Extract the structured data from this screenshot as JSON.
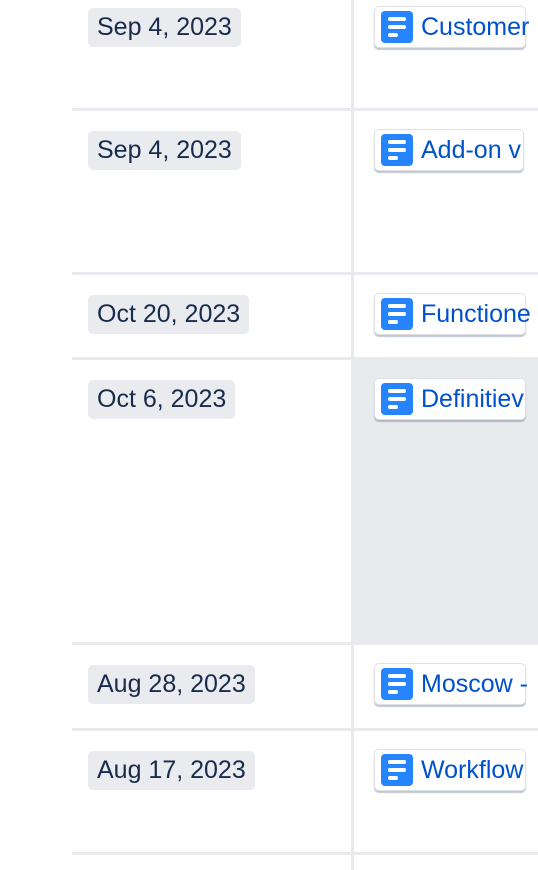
{
  "rows": [
    {
      "date": "Sep 4, 2023",
      "page": "Customer"
    },
    {
      "date": "Sep 4, 2023",
      "page": "Add-on v"
    },
    {
      "date": "Oct 20, 2023",
      "page": "Functione"
    },
    {
      "date": "Oct 6, 2023",
      "page": "Definitiev"
    },
    {
      "date": "Aug 28, 2023",
      "page": "Moscow -"
    },
    {
      "date": "Aug 17, 2023",
      "page": "Workflow"
    },
    {
      "date": "",
      "page": ""
    }
  ],
  "colors": {
    "link": "#0052cc",
    "icon": "#2684ff",
    "chip": "#eaebef",
    "highlight": "#e9eaee"
  }
}
